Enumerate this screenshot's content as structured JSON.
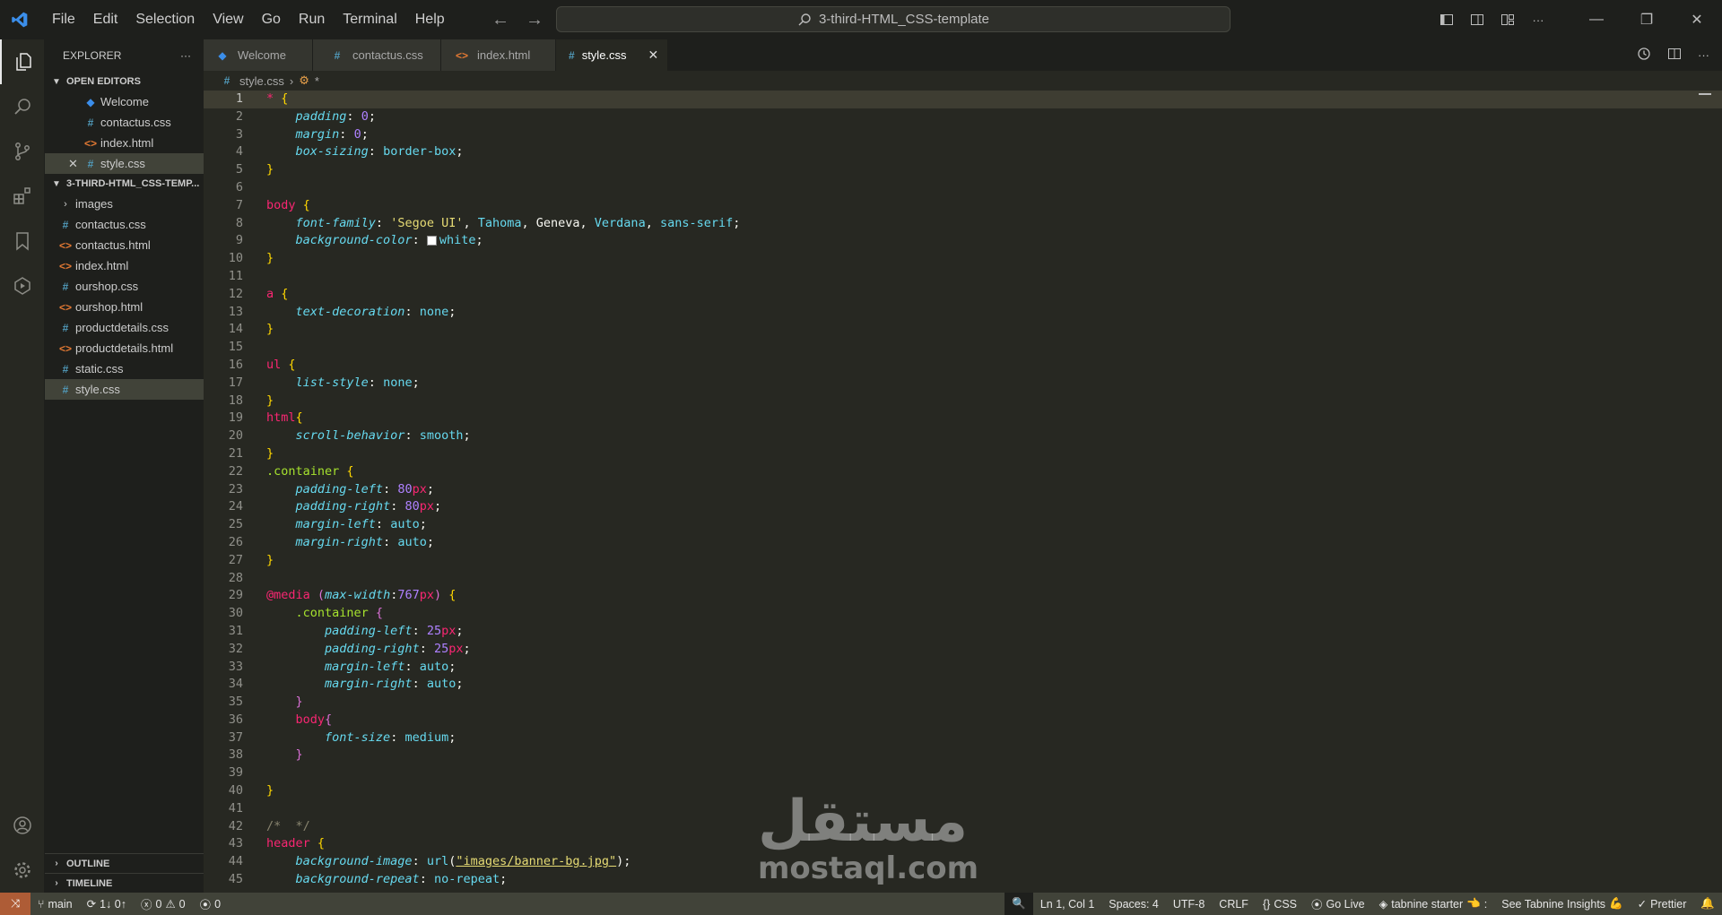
{
  "titlebar": {
    "menu": [
      "File",
      "Edit",
      "Selection",
      "View",
      "Go",
      "Run",
      "Terminal",
      "Help"
    ],
    "search_text": "3-third-HTML_CSS-template"
  },
  "sidebar": {
    "header": "EXPLORER",
    "open_editors_title": "OPEN EDITORS",
    "open_editors": [
      {
        "name": "Welcome",
        "type": "vsc"
      },
      {
        "name": "contactus.css",
        "type": "css"
      },
      {
        "name": "index.html",
        "type": "html"
      },
      {
        "name": "style.css",
        "type": "css"
      }
    ],
    "folder_title": "3-THIRD-HTML_CSS-TEMP...",
    "files": [
      {
        "name": "images",
        "type": "folder"
      },
      {
        "name": "contactus.css",
        "type": "css"
      },
      {
        "name": "contactus.html",
        "type": "html"
      },
      {
        "name": "index.html",
        "type": "html"
      },
      {
        "name": "ourshop.css",
        "type": "css"
      },
      {
        "name": "ourshop.html",
        "type": "html"
      },
      {
        "name": "productdetails.css",
        "type": "css"
      },
      {
        "name": "productdetails.html",
        "type": "html"
      },
      {
        "name": "static.css",
        "type": "css"
      },
      {
        "name": "style.css",
        "type": "css"
      }
    ],
    "outline": "OUTLINE",
    "timeline": "TIMELINE"
  },
  "tabs": [
    {
      "label": "Welcome",
      "type": "vsc"
    },
    {
      "label": "contactus.css",
      "type": "css"
    },
    {
      "label": "index.html",
      "type": "html"
    },
    {
      "label": "style.css",
      "type": "css"
    }
  ],
  "breadcrumb": {
    "file": "style.css",
    "symbol": "*"
  },
  "code_lines": [
    "* {",
    "    padding: 0;",
    "    margin: 0;",
    "    box-sizing: border-box;",
    "}",
    "",
    "body {",
    "    font-family: 'Segoe UI', Tahoma, Geneva, Verdana, sans-serif;",
    "    background-color: white;",
    "}",
    "",
    "a {",
    "    text-decoration: none;",
    "}",
    "",
    "ul {",
    "    list-style: none;",
    "}",
    "html{",
    "    scroll-behavior: smooth;",
    "}",
    ".container {",
    "    padding-left: 80px;",
    "    padding-right: 80px;",
    "    margin-left: auto;",
    "    margin-right: auto;",
    "}",
    "",
    "@media (max-width:767px) {",
    "    .container {",
    "        padding-left: 25px;",
    "        padding-right: 25px;",
    "        margin-left: auto;",
    "        margin-right: auto;",
    "    }",
    "    body{",
    "        font-size: medium;",
    "    }",
    "",
    "}",
    "",
    "/*  */",
    "header {",
    "    background-image: url(\"images/banner-bg.jpg\");",
    "    background-repeat: no-repeat;"
  ],
  "watermark": {
    "arabic": "مستقل",
    "latin": "mostaql.com"
  },
  "statusbar": {
    "branch": "main",
    "sync": "1↓ 0↑",
    "errors": "0",
    "warnings": "0",
    "ports": "0",
    "position": "Ln 1, Col 1",
    "spaces": "Spaces: 4",
    "encoding": "UTF-8",
    "eol": "CRLF",
    "language": "CSS",
    "golive": "Go Live",
    "tabnine": "tabnine starter",
    "insights": "See Tabnine Insights",
    "prettier": "Prettier"
  },
  "colors": {
    "accent_remote": "#ae5c36",
    "selector": "#f92672",
    "property": "#66d9ef",
    "string": "#e6db74",
    "number": "#ae81ff"
  }
}
